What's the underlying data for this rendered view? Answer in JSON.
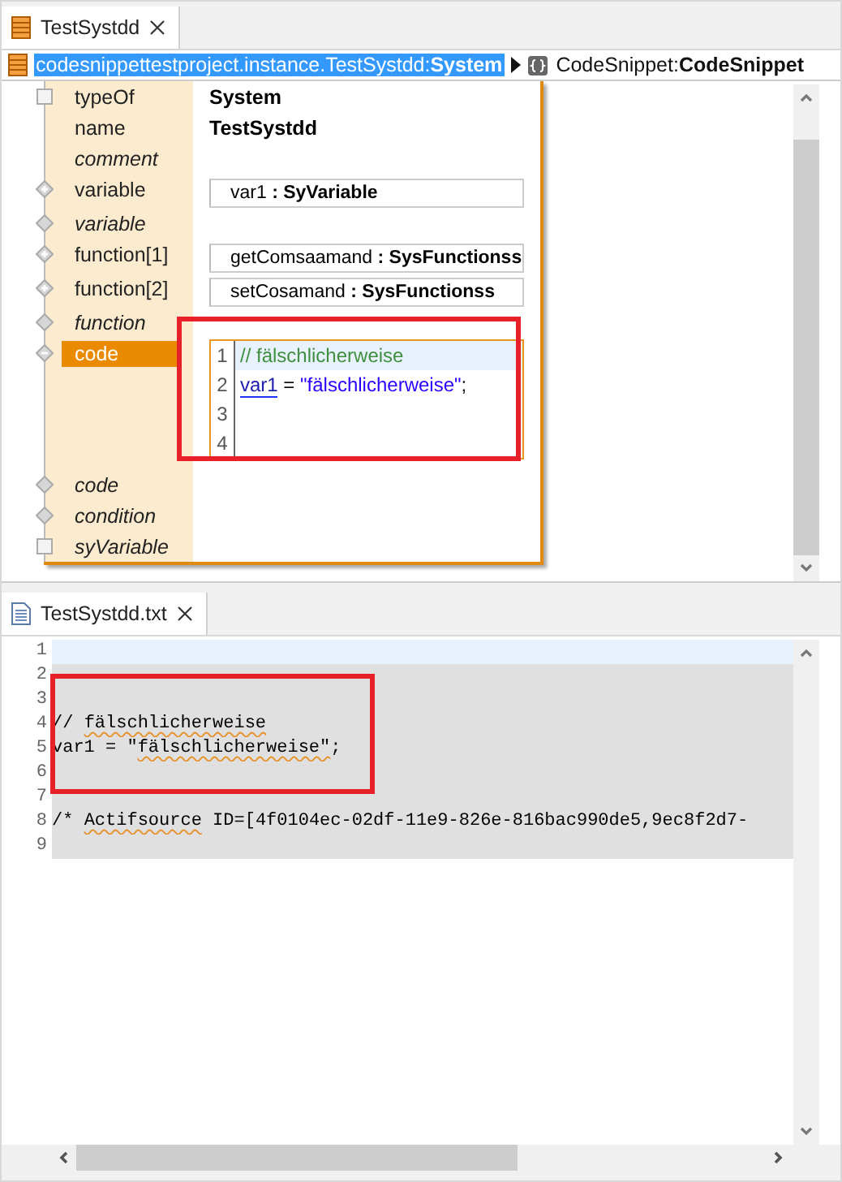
{
  "editor_tab": {
    "title": "TestSystdd",
    "selected": true
  },
  "breadcrumb": [
    {
      "text": "codesnippettestproject.instance.TestSystdd:**System**",
      "selected": true,
      "kind": "resource"
    },
    {
      "text": "CodeSnippet:**CodeSnippet**",
      "selected": false,
      "kind": "snippet"
    }
  ],
  "properties": [
    {
      "label": "typeOf",
      "kind": "square",
      "italic": false,
      "selected": false,
      "value": {
        "kind": "text",
        "text": "System"
      }
    },
    {
      "label": "name",
      "kind": "none",
      "italic": false,
      "selected": false,
      "value": {
        "kind": "text",
        "text": "TestSystdd"
      }
    },
    {
      "label": "comment",
      "kind": "none",
      "italic": true,
      "selected": false
    },
    {
      "label": "variable",
      "kind": "plus",
      "italic": false,
      "selected": false,
      "value": {
        "kind": "ref",
        "text": "var1 **: SyVariable**"
      }
    },
    {
      "label": "variable",
      "kind": "diamond",
      "italic": true,
      "selected": false
    },
    {
      "label": "function[1]",
      "kind": "plus",
      "italic": false,
      "selected": false,
      "value": {
        "kind": "ref",
        "text": "getComsaamand **: SysFunctionss**"
      }
    },
    {
      "label": "function[2]",
      "kind": "plus",
      "italic": false,
      "selected": false,
      "value": {
        "kind": "ref",
        "text": "setCosamand **: SysFunctionss**"
      }
    },
    {
      "label": "function",
      "kind": "diamond",
      "italic": true,
      "selected": false
    },
    {
      "label": "code",
      "kind": "minus",
      "italic": false,
      "selected": true,
      "value": {
        "kind": "code",
        "boxed": true,
        "lines": [
          {
            "number": "1",
            "current": true,
            "tokens": [
              {
                "kind": "comment",
                "text": "// fälschlicherweise"
              }
            ]
          },
          {
            "number": "2",
            "current": false,
            "tokens": [
              {
                "kind": "variable",
                "text": "var1"
              },
              {
                "kind": "plain",
                "text": " = "
              },
              {
                "kind": "string",
                "text": "\"fälschlicherweise\""
              },
              {
                "kind": "plain",
                "text": ";"
              }
            ]
          },
          {
            "number": "3",
            "current": false
          },
          {
            "number": "4",
            "current": false
          }
        ]
      }
    },
    {
      "label": "code",
      "kind": "diamond",
      "italic": true,
      "selected": false
    },
    {
      "label": "condition",
      "kind": "diamond",
      "italic": true,
      "selected": false
    },
    {
      "label": "syVariable",
      "kind": "square",
      "italic": true,
      "selected": false
    }
  ],
  "text_tab": {
    "title": "TestSystdd.txt",
    "selected": true
  },
  "text_file": {
    "highlight_frame": true,
    "lines": [
      {
        "number": "1",
        "current": true,
        "shaded": false
      },
      {
        "number": "2",
        "current": false,
        "shaded": true
      },
      {
        "number": "3",
        "current": false,
        "shaded": true
      },
      {
        "number": "4",
        "current": false,
        "shaded": true,
        "tokens": [
          {
            "text": "// "
          },
          {
            "text": "fälschlicherweise",
            "misspelled": true
          }
        ]
      },
      {
        "number": "5",
        "current": false,
        "shaded": true,
        "tokens": [
          {
            "text": "var1 = \""
          },
          {
            "text": "fälschlicherweise\"",
            "misspelled": true
          },
          {
            "text": ";"
          }
        ]
      },
      {
        "number": "6",
        "current": false,
        "shaded": true
      },
      {
        "number": "7",
        "current": false,
        "shaded": true
      },
      {
        "number": "8",
        "current": false,
        "shaded": true,
        "tokens": [
          {
            "text": "/* "
          },
          {
            "text": "Actifsource",
            "misspelled": true
          },
          {
            "text": " ID=[4f0104ec-02df-11e9-826e-816bac990de5,9ec8f2d7-"
          }
        ]
      },
      {
        "number": "9",
        "current": false,
        "shaded": true
      }
    ]
  }
}
